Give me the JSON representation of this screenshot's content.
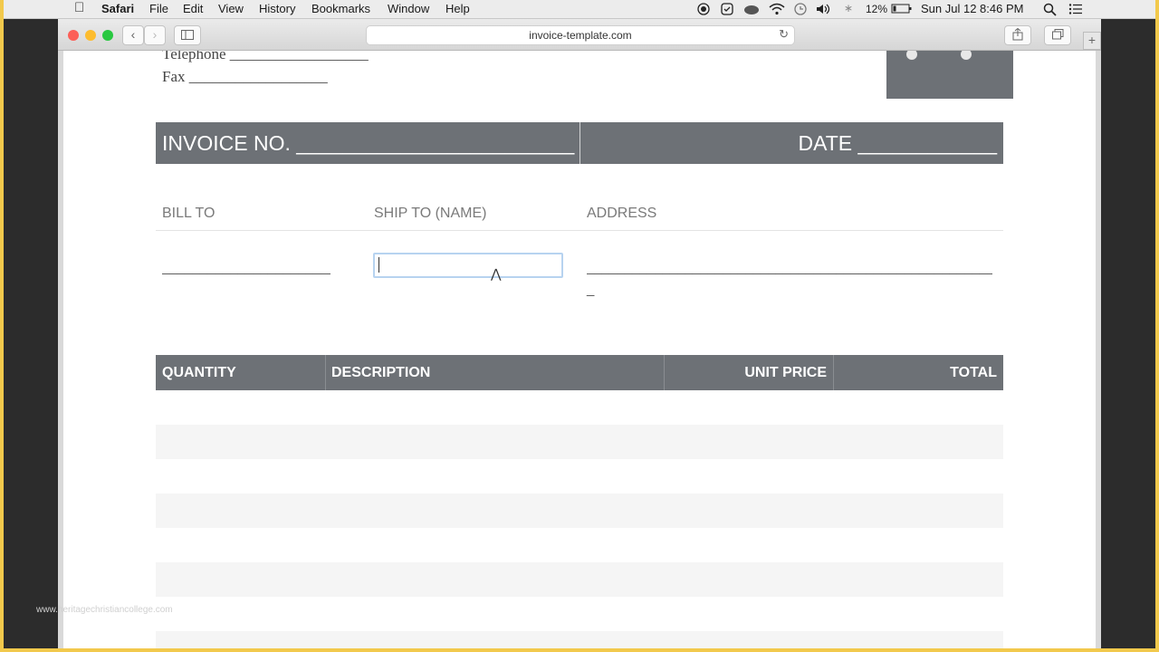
{
  "menubar": {
    "app": "Safari",
    "items": [
      "File",
      "Edit",
      "View",
      "History",
      "Bookmarks",
      "Window",
      "Help"
    ],
    "battery": "12%",
    "clock": "Sun Jul 12  8:46 PM"
  },
  "browser": {
    "url": "invoice-template.com"
  },
  "invoice": {
    "telephone_label": "Telephone __________________",
    "fax_label": "Fax __________________",
    "invoice_no_label": "INVOICE NO. ________________________",
    "date_label": "DATE ____________",
    "bill_to_label": "BILL TO",
    "ship_to_label": "SHIP TO (NAME)",
    "address_label": "ADDRESS",
    "bill_to_blank": "____________________________",
    "address_blank": "____________________________________________________________________",
    "address_blank2": "_",
    "columns": {
      "quantity": "QUANTITY",
      "description": "DESCRIPTION",
      "unit_price": "UNIT PRICE",
      "total": "TOTAL"
    }
  },
  "watermark": "www.heritagechristiancollege.com"
}
